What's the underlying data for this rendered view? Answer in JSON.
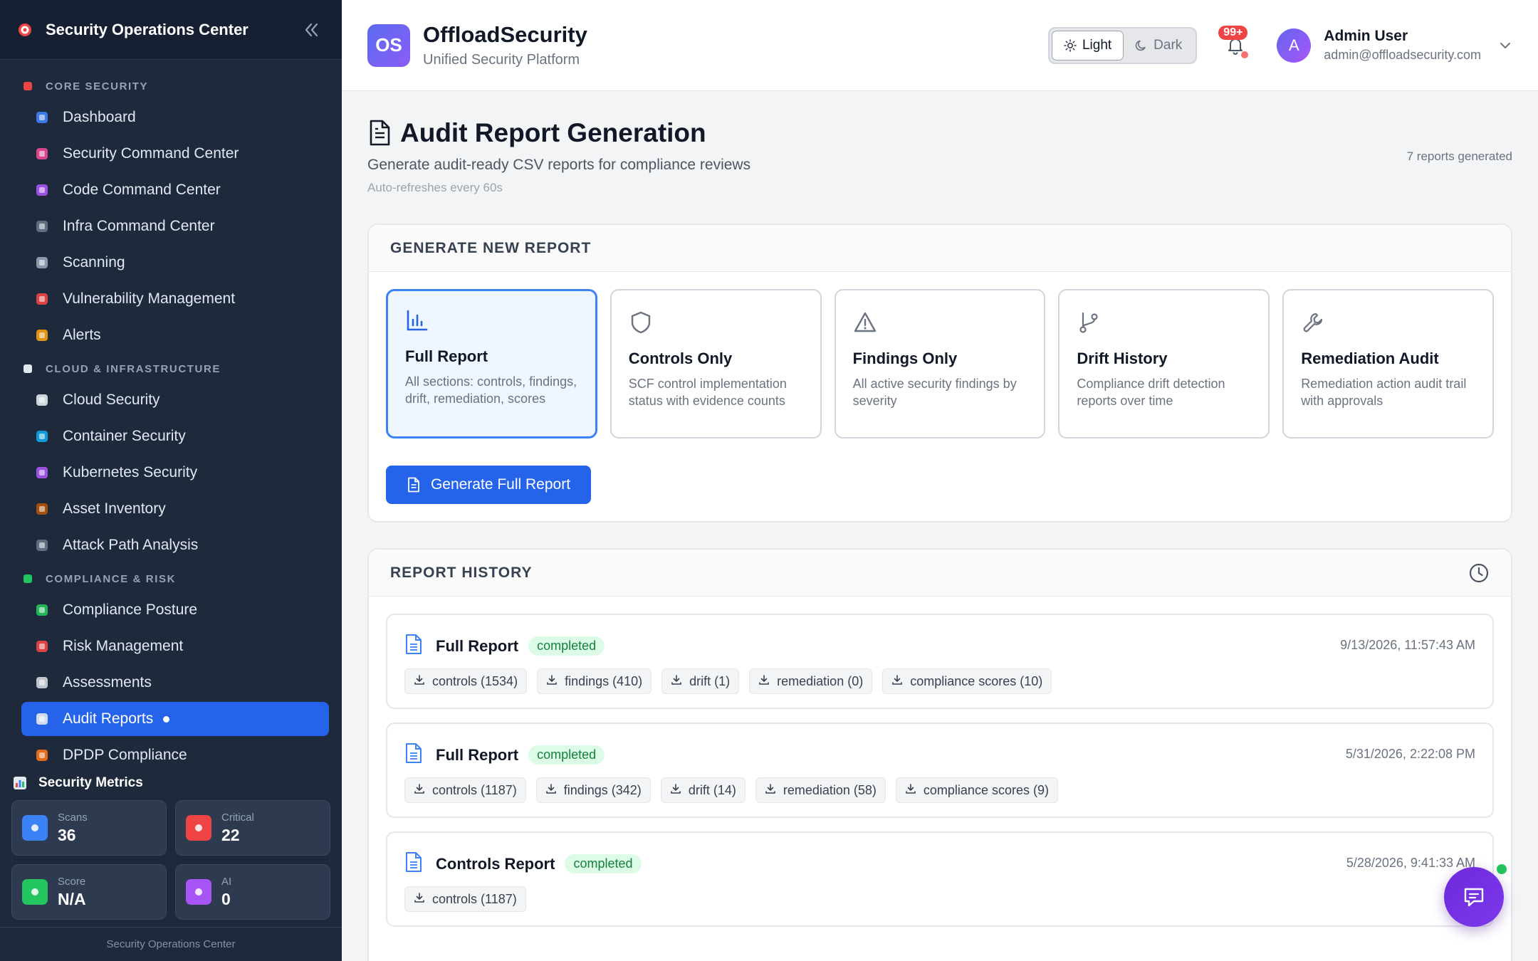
{
  "sidebar": {
    "title": "Security Operations Center",
    "footer": "Security Operations Center",
    "sections": [
      {
        "label": "CORE SECURITY",
        "items": [
          {
            "label": "Dashboard",
            "color": "#3b82f6"
          },
          {
            "label": "Security Command Center",
            "color": "#ec4899"
          },
          {
            "label": "Code Command Center",
            "color": "#a855f7"
          },
          {
            "label": "Infra Command Center",
            "color": "#64748b"
          },
          {
            "label": "Scanning",
            "color": "#94a3b8"
          },
          {
            "label": "Vulnerability Management",
            "color": "#ef4444"
          },
          {
            "label": "Alerts",
            "color": "#f59e0b"
          }
        ]
      },
      {
        "label": "CLOUD & INFRASTRUCTURE",
        "items": [
          {
            "label": "Cloud Security",
            "color": "#e2e8f0"
          },
          {
            "label": "Container Security",
            "color": "#0ea5e9"
          },
          {
            "label": "Kubernetes Security",
            "color": "#a855f7"
          },
          {
            "label": "Asset Inventory",
            "color": "#b45309"
          },
          {
            "label": "Attack Path Analysis",
            "color": "#64748b"
          }
        ]
      },
      {
        "label": "COMPLIANCE & RISK",
        "items": [
          {
            "label": "Compliance Posture",
            "color": "#22c55e"
          },
          {
            "label": "Risk Management",
            "color": "#ef4444"
          },
          {
            "label": "Assessments",
            "color": "#d1d5db"
          },
          {
            "label": "Audit Reports",
            "color": "#e2e8f0",
            "active": true
          },
          {
            "label": "DPDP Compliance",
            "color": "#f97316"
          }
        ]
      }
    ],
    "metrics": {
      "title": "Security Metrics",
      "cards": [
        {
          "label": "Scans",
          "value": "36",
          "color": "#3b82f6"
        },
        {
          "label": "Critical",
          "value": "22",
          "color": "#ef4444"
        },
        {
          "label": "Score",
          "value": "N/A",
          "color": "#22c55e"
        },
        {
          "label": "AI",
          "value": "0",
          "color": "#a855f7"
        }
      ]
    }
  },
  "header": {
    "badge": "OS",
    "brand": "OffloadSecurity",
    "subtitle": "Unified Security Platform",
    "theme_light": "Light",
    "theme_dark": "Dark",
    "notifications": "99+",
    "avatar_letter": "A",
    "user_name": "Admin User",
    "user_email": "admin@offloadsecurity.com"
  },
  "page": {
    "title": "Audit Report Generation",
    "subtitle": "Generate audit-ready CSV reports for compliance reviews",
    "refresh_note": "Auto-refreshes every 60s",
    "count": "7 reports generated"
  },
  "generate": {
    "title": "GENERATE NEW REPORT",
    "button": "Generate Full Report",
    "types": [
      {
        "name": "Full Report",
        "desc": "All sections: controls, findings, drift, remediation, scores",
        "icon": "bar-chart-icon",
        "selected": true
      },
      {
        "name": "Controls Only",
        "desc": "SCF control implementation status with evidence counts",
        "icon": "shield-icon"
      },
      {
        "name": "Findings Only",
        "desc": "All active security findings by severity",
        "icon": "warning-icon"
      },
      {
        "name": "Drift History",
        "desc": "Compliance drift detection reports over time",
        "icon": "git-branch-icon"
      },
      {
        "name": "Remediation Audit",
        "desc": "Remediation action audit trail with approvals",
        "icon": "wrench-icon"
      }
    ]
  },
  "history": {
    "title": "REPORT HISTORY",
    "reports": [
      {
        "name": "Full Report",
        "status": "completed",
        "date": "9/13/2026, 11:57:43 AM",
        "files": [
          "controls (1534)",
          "findings (410)",
          "drift (1)",
          "remediation (0)",
          "compliance scores (10)"
        ]
      },
      {
        "name": "Full Report",
        "status": "completed",
        "date": "5/31/2026, 2:22:08 PM",
        "files": [
          "controls (1187)",
          "findings (342)",
          "drift (14)",
          "remediation (58)",
          "compliance scores (9)"
        ]
      },
      {
        "name": "Controls Report",
        "status": "completed",
        "date": "5/28/2026, 9:41:33 AM",
        "files": [
          "controls (1187)"
        ]
      }
    ]
  }
}
